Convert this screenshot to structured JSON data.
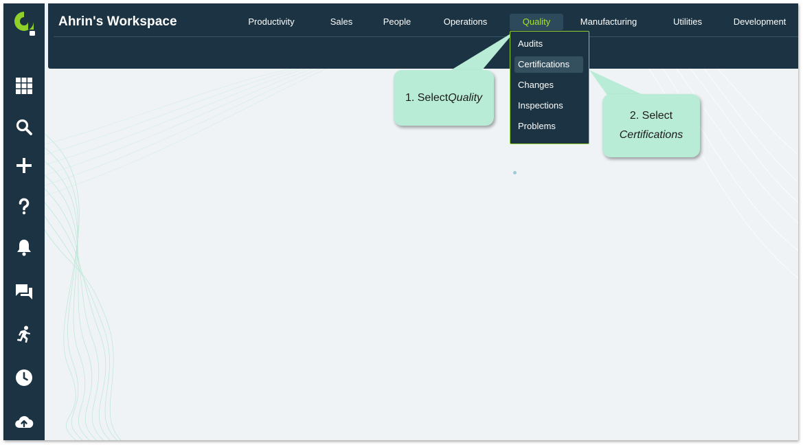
{
  "workspace": {
    "title": "Ahrin's Workspace"
  },
  "nav": {
    "items": [
      {
        "label": "Productivity"
      },
      {
        "label": "Sales"
      },
      {
        "label": "People"
      },
      {
        "label": "Operations"
      },
      {
        "label": "Quality"
      },
      {
        "label": "Manufacturing"
      },
      {
        "label": "Utilities"
      },
      {
        "label": "Development"
      }
    ],
    "active": "Quality"
  },
  "dropdown": {
    "items": [
      {
        "label": "Audits"
      },
      {
        "label": "Certifications"
      },
      {
        "label": "Changes"
      },
      {
        "label": "Inspections"
      },
      {
        "label": "Problems"
      }
    ],
    "highlighted": "Certifications"
  },
  "sidebar": {
    "icons": [
      "apps-grid-icon",
      "search-icon",
      "add-icon",
      "help-icon",
      "bell-icon",
      "chat-icon",
      "activity-icon",
      "clock-icon",
      "cloud-upload-icon"
    ]
  },
  "callouts": {
    "step1": {
      "text": "1. Select ",
      "emphasis": "Quality"
    },
    "step2": {
      "text": "2. Select",
      "emphasis": "Certifications"
    }
  },
  "colors": {
    "dark_navy": "#1b3342",
    "accent_green": "#a4e32c",
    "callout_mint": "#b9ecd6",
    "background": "#eff3f6"
  }
}
